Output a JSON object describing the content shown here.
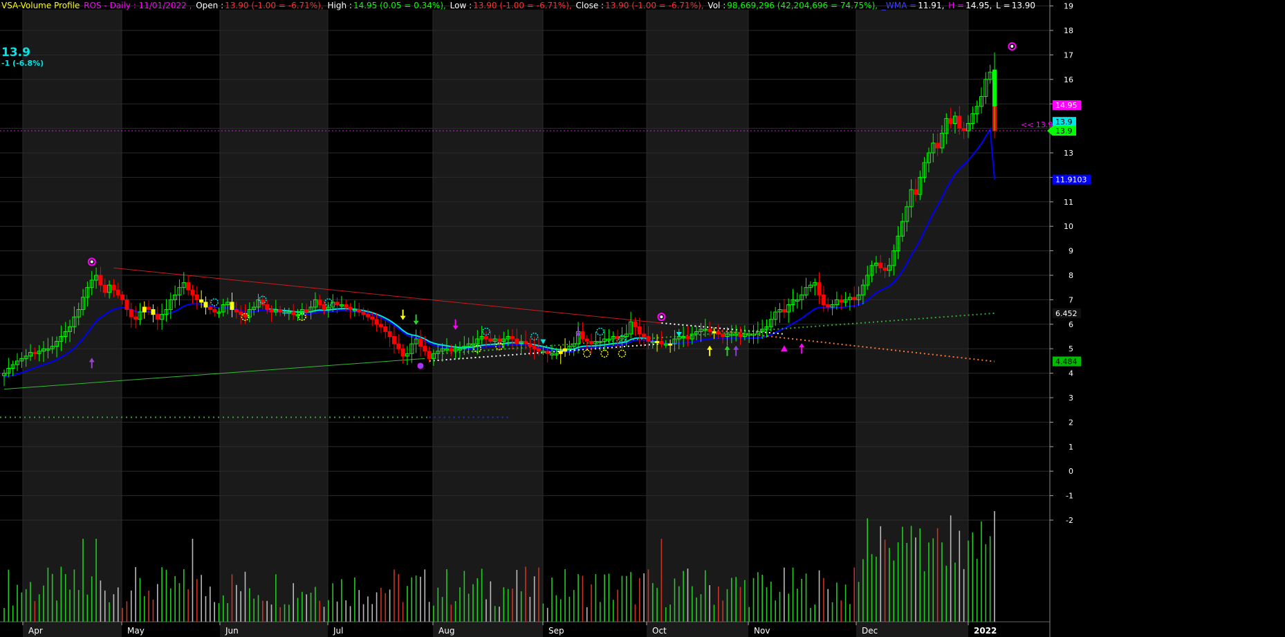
{
  "header": {
    "indicator": "VSA-Volume Profile",
    "symbol": "ROS - Daily : 11/01/2022 ,",
    "open_label": "Open :",
    "open_value": "13.90 (-1.00 = -6.71%),",
    "high_label": "High :",
    "high_value": "14.95 (0.05 = 0.34%),",
    "low_label": "Low :",
    "low_value": "13.90 (-1.00 = -6.71%),",
    "close_label": "Close :",
    "close_value": "13.90 (-1.00 = -6.71%),",
    "vol_label": "Vol :",
    "vol_value": "98,669,296 (42,204,696 = 74.75%),",
    "wma_label": "_WMA =",
    "wma_value": "11.91,",
    "h_label": "H =",
    "h_value": "14.95,",
    "l_label": "L =",
    "l_value": "13.90"
  },
  "last_price": "13.9",
  "last_change": "-1 (-6.8%)",
  "colors": {
    "background": "#000000",
    "band": "#1a1a1a",
    "grid": "#2b2b2b",
    "up": "#00ff00",
    "down": "#ff0000",
    "neutral": "#ffff00",
    "wma": "#0000ff",
    "cyan": "#00e5e5",
    "magenta": "#ff00ff",
    "trend_red": "#cc1a1a",
    "trend_green": "#33bb33",
    "orange": "#ff7733",
    "axis_text": "#ffffff"
  },
  "chart_data": {
    "type": "candlestick",
    "y_ticks": [
      "19",
      "18",
      "17",
      "16",
      "15",
      "14",
      "13",
      "12",
      "11",
      "10",
      "9",
      "8",
      "7",
      "6",
      "5",
      "4",
      "3",
      "2",
      "1",
      "0",
      "-1",
      "-2"
    ],
    "x_labels": [
      "Apr",
      "May",
      "Jun",
      "Jul",
      "Aug",
      "Sep",
      "Oct",
      "Nov",
      "Dec",
      "2022"
    ],
    "price_labels": [
      {
        "value": 14.95,
        "text": "14.95",
        "bg": "#ff00ff",
        "fg": "#ffffff"
      },
      {
        "value": 13.9,
        "text": "13.9",
        "bg": "#00e5e5",
        "fg": "#000000"
      },
      {
        "value": 13.9,
        "text": "13.9",
        "bg": "#00ff00",
        "fg": "#000000"
      },
      {
        "value": 11.91,
        "text": "11.9103",
        "bg": "#0000ff",
        "fg": "#ffffff"
      },
      {
        "value": 6.452,
        "text": "6.452",
        "bg": "#111111",
        "fg": "#ffffff"
      },
      {
        "value": 4.484,
        "text": "4.484",
        "bg": "#00bb00",
        "fg": "#000000"
      }
    ],
    "last_close_marker": "<< 13.9",
    "last_close": 13.9,
    "closes": [
      4.0,
      4.2,
      4.35,
      4.5,
      4.6,
      4.7,
      4.85,
      4.8,
      4.9,
      5.0,
      5.0,
      5.1,
      5.3,
      5.5,
      5.7,
      5.9,
      6.3,
      6.6,
      7.1,
      7.5,
      7.8,
      8.0,
      7.6,
      7.3,
      7.6,
      7.4,
      7.2,
      7.0,
      6.6,
      6.3,
      6.2,
      6.5,
      6.7,
      6.6,
      6.4,
      6.2,
      6.4,
      6.6,
      7.0,
      7.2,
      7.5,
      7.7,
      7.4,
      7.2,
      7.0,
      6.9,
      6.7,
      6.6,
      6.5,
      6.5,
      6.8,
      6.9,
      6.6,
      6.5,
      6.4,
      6.3,
      6.6,
      6.7,
      7.0,
      6.8,
      6.6,
      6.5,
      6.6,
      6.5,
      6.5,
      6.5,
      6.4,
      6.4,
      6.6,
      6.5,
      6.7,
      7.0,
      6.8,
      6.6,
      6.7,
      6.9,
      6.8,
      6.8,
      6.7,
      6.6,
      6.6,
      6.5,
      6.4,
      6.3,
      6.2,
      6.0,
      5.9,
      5.7,
      5.5,
      5.2,
      5.0,
      4.7,
      4.8,
      5.2,
      5.4,
      5.1,
      4.9,
      4.6,
      4.8,
      4.9,
      5.0,
      5.0,
      4.9,
      5.0,
      5.0,
      5.1,
      5.2,
      5.2,
      5.4,
      5.5,
      5.4,
      5.3,
      5.4,
      5.3,
      5.4,
      5.5,
      5.4,
      5.2,
      5.3,
      5.2,
      5.1,
      5.0,
      4.9,
      4.9,
      4.8,
      4.8,
      4.8,
      4.9,
      5.0,
      5.1,
      5.2,
      5.7,
      5.4,
      5.3,
      5.2,
      5.3,
      5.3,
      5.4,
      5.4,
      5.5,
      5.4,
      5.5,
      5.6,
      6.1,
      5.9,
      5.6,
      5.5,
      5.3,
      5.3,
      5.3,
      5.2,
      5.2,
      5.2,
      5.4,
      5.5,
      5.5,
      5.4,
      5.6,
      5.7,
      5.8,
      5.8,
      5.7,
      5.7,
      5.6,
      5.5,
      5.6,
      5.6,
      5.6,
      5.5,
      5.6,
      5.6,
      5.6,
      5.7,
      5.8,
      5.9,
      6.2,
      6.5,
      6.6,
      6.5,
      6.8,
      7.0,
      7.0,
      7.2,
      7.5,
      7.6,
      7.7,
      7.2,
      6.8,
      6.7,
      6.8,
      7.0,
      6.9,
      7.0,
      7.1,
      7.0,
      7.2,
      7.6,
      8.0,
      8.4,
      8.5,
      8.3,
      8.2,
      8.4,
      9.0,
      9.6,
      10.2,
      10.8,
      11.5,
      11.3,
      12.0,
      12.6,
      13.0,
      13.4,
      13.2,
      13.8,
      14.4,
      14.2,
      14.5,
      14.0,
      13.9,
      14.2,
      14.6,
      14.9,
      15.3,
      16.0,
      16.3,
      13.9
    ],
    "volume_yrange": [
      0,
      160000000
    ],
    "y_range": [
      -2,
      19
    ],
    "trendlines": [
      {
        "name": "",
        "color": "#cc1a1a",
        "style": "solid",
        "from": [
          8.5
        ],
        "to": [
          6.0
        ]
      },
      {
        "name": "",
        "color": "#33bb33",
        "style": "solid",
        "from": [
          3.4
        ],
        "to": [
          4.6
        ]
      }
    ]
  }
}
